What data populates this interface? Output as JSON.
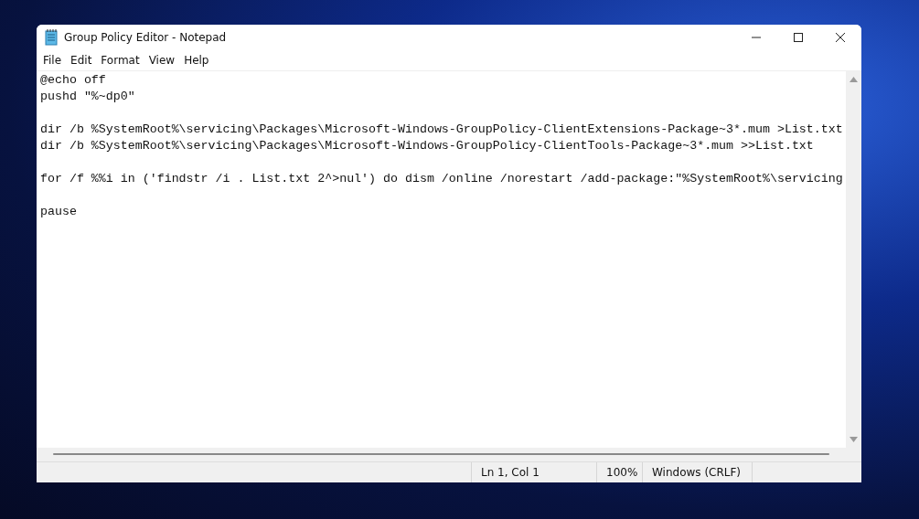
{
  "window": {
    "title": "Group Policy Editor - Notepad"
  },
  "menu": [
    "File",
    "Edit",
    "Format",
    "View",
    "Help"
  ],
  "editor": {
    "blocks": [
      [
        "@echo off",
        "pushd \"%~dp0\""
      ],
      [
        "dir /b %SystemRoot%\\servicing\\Packages\\Microsoft-Windows-GroupPolicy-ClientExtensions-Package~3*.mum >List.txt",
        "dir /b %SystemRoot%\\servicing\\Packages\\Microsoft-Windows-GroupPolicy-ClientTools-Package~3*.mum >>List.txt"
      ],
      [
        "for /f %%i in ('findstr /i . List.txt 2^>nul') do dism /online /norestart /add-package:\"%SystemRoot%\\servicing"
      ],
      [
        "pause"
      ]
    ]
  },
  "status_bar": {
    "position": "Ln 1, Col 1",
    "zoom": "100%",
    "line_ending": "Windows (CRLF)"
  }
}
